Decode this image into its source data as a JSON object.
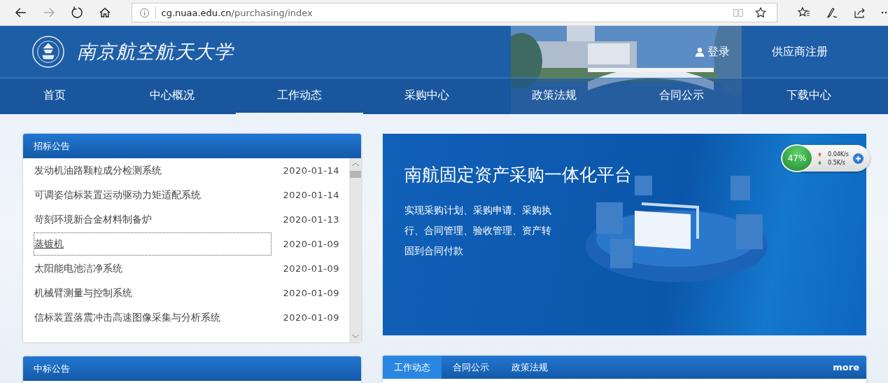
{
  "browser": {
    "url_host": "cg.nuaa.edu.cn",
    "url_path": "/purchasing/index",
    "forward_disabled": true
  },
  "header": {
    "site_title": "南京航空航天大学",
    "login": "登录",
    "register": "供应商注册"
  },
  "nav": [
    {
      "label": "首页",
      "selected": false
    },
    {
      "label": "中心概况",
      "selected": false
    },
    {
      "label": "工作动态",
      "selected": true
    },
    {
      "label": "采购中心",
      "selected": false
    },
    {
      "label": "政策法规",
      "selected": false
    },
    {
      "label": "合同公示",
      "selected": false
    },
    {
      "label": "下载中心",
      "selected": false
    }
  ],
  "tender_panel": {
    "title": "招标公告",
    "items": [
      {
        "title": "发动机油路颗粒成分检测系统",
        "date": "2020-01-14",
        "focused": false
      },
      {
        "title": "可调姿信标装置运动驱动力矩适配系统",
        "date": "2020-01-14",
        "focused": false
      },
      {
        "title": "苛刻环境新合金材料制备炉",
        "date": "2020-01-13",
        "focused": false
      },
      {
        "title": "蒸镀机",
        "date": "2020-01-09",
        "focused": true
      },
      {
        "title": "太阳能电池洁净系统",
        "date": "2020-01-09",
        "focused": false
      },
      {
        "title": "机械臂测量与控制系统",
        "date": "2020-01-09",
        "focused": false
      },
      {
        "title": "信标装置落震冲击高速图像采集与分析系统",
        "date": "2020-01-09",
        "focused": false
      }
    ]
  },
  "banner": {
    "title": "南航固定资产采购一体化平台",
    "lines": [
      "实现采购计划、采购申请、采购执",
      "行、合同管理、验收管理、资产转",
      "固到合同付款"
    ]
  },
  "speed_widget": {
    "percent": "47%",
    "upload": "0.04K/s",
    "download": "0.5K/s"
  },
  "award_panel": {
    "title": "中标公告"
  },
  "news_panel": {
    "tabs": [
      {
        "label": "工作动态",
        "selected": true
      },
      {
        "label": "合同公示",
        "selected": false
      },
      {
        "label": "政策法规",
        "selected": false
      }
    ],
    "more": "more"
  }
}
